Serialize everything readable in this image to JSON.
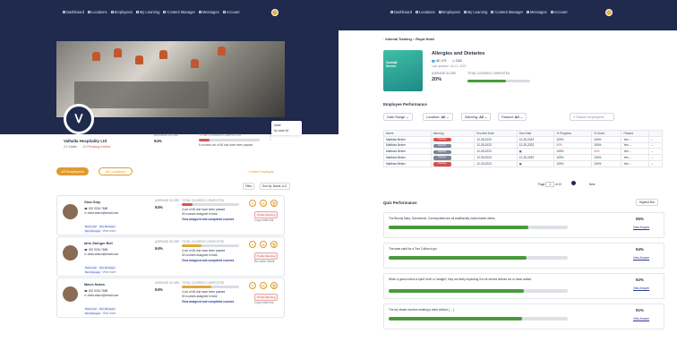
{
  "left": {
    "nav": [
      "Dashboard",
      "Locations",
      "Employees",
      "My Learning",
      "Content Manager",
      "Messages",
      "Account"
    ],
    "company": {
      "name": "Valhalla Hospitality Ltd",
      "staffs": "21 Staffs",
      "pending": "12 Pending Invites",
      "avg_label": "AVERAGE SCORE",
      "avg_value": "94%",
      "total_label": "TOTAL COURSES COMPLETED",
      "total_note": "8 courses out of 48 due have been passed",
      "progress": 0.17
    },
    "popover": {
      "line1": "Invite",
      "line2": "for route 40"
    },
    "tabs": {
      "all": "All Employees",
      "all_locations": "All Locations"
    },
    "invite": "+ Invite Employee",
    "filters": "Filter",
    "sort": "Sort by: Name, A-Z",
    "employees": [
      {
        "name": "Gina Gray",
        "phone": "002 9234 7688",
        "email": "olivia.wilson@email.com",
        "tags": [
          "Bartender",
          "Bar Manager"
        ],
        "tags2": [
          "Bar Manager"
        ],
        "more": "View more",
        "avg": "94%",
        "avg_label": "AVERAGE SCORE",
        "total_label": "TOTAL COURSES COMPLETED",
        "line1": "4 out of 48 due have been passed",
        "line2": "30 courses assigned in total",
        "link": "View assigned and completed courses",
        "progress": 0.18,
        "color": "#d25a4f",
        "warn": "Profile Warning",
        "inv": "Copy invite link"
      },
      {
        "name": "Idris Stringer Bell",
        "phone": "002 9234 7688",
        "email": "olivia.wilson@email.com",
        "tags": [
          "Bartender",
          "Bar Manager"
        ],
        "tags2": [
          "Bar Manager"
        ],
        "more": "View more",
        "avg": "94%",
        "avg_label": "AVERAGE SCORE",
        "total_label": "TOTAL COURSES COMPLETED",
        "line1": "4 out of 48 due have been passed",
        "line2": "30 courses assigned in total",
        "link": "View assigned and completed courses",
        "progress": 0.34,
        "color": "#e0a93c",
        "warn": "Profile Warning",
        "inv": "Re-invite Delete"
      },
      {
        "name": "Mavis Nokes",
        "phone": "002 9234 7688",
        "email": "olivia.wilson@email.com",
        "tags": [
          "Bartender",
          "Bar Manager"
        ],
        "tags2": [
          "Bar Manager"
        ],
        "more": "View more",
        "avg": "94%",
        "avg_label": "AVERAGE SCORE",
        "total_label": "TOTAL COURSES COMPLETED",
        "line1": "4 out of 48 due have been passed",
        "line2": "30 courses assigned in total",
        "link": "View assigned and completed courses",
        "progress": 0.52,
        "color": "#e0a93c",
        "warn": "Profile Warning",
        "inv": "Copy invite link"
      }
    ]
  },
  "right": {
    "nav": [
      "Dashboard",
      "Locations",
      "Employees",
      "My Learning",
      "Content Manager",
      "Messages",
      "Account"
    ],
    "breadcrumb": {
      "part1": "Internal Training",
      "sep": ">",
      "part2": "Royal Hotel"
    },
    "course": {
      "thumb": "Cocktail Service",
      "title": "Allergies and Dietaries",
      "stat1": "48 / 473",
      "stat2": "1163",
      "updated": "Last updated: Oct 12, 2023",
      "avg_label": "AVERAGE SCORE",
      "avg": "20%",
      "total_label": "TOTAL COURSES COMPLETED",
      "progress": 0.62
    },
    "perf_title": "Employee Performance",
    "filters": [
      {
        "label": "Date Range"
      },
      {
        "label": "Location:",
        "value": "All"
      },
      {
        "label": "Warning:",
        "value": "All"
      },
      {
        "label": "Passed:",
        "value": "All"
      }
    ],
    "search": "Search employees",
    "headers": [
      "Name",
      "Warning",
      "Enrolled Date",
      "Due Date",
      "% Progress",
      "% Score",
      "Passed"
    ],
    "rows": [
      {
        "name": "Matthias Beiser",
        "status": "Overdue",
        "enrolled": "12-25-2023",
        "due": "12-25-2023",
        "progress": "100%",
        "score": "100%",
        "passed": "Yes"
      },
      {
        "name": "Matthias Beiser",
        "status": "Expired",
        "enrolled": "12-25-2023",
        "due": "12-25-2023",
        "progress": "50%",
        "score": "100%",
        "passed": "Yes"
      },
      {
        "name": "Matthias Beiser",
        "status": "Expired",
        "enrolled": "12-25-2023",
        "due": "",
        "progress": "100%",
        "score": "40%",
        "passed": "Yes"
      },
      {
        "name": "Matthias Beiser",
        "status": "Expired",
        "enrolled": "12-25-2023",
        "due": "12-25-2023",
        "progress": "100%",
        "score": "100%",
        "passed": "Yes"
      },
      {
        "name": "Matthias Beiser",
        "status": "Overdue",
        "enrolled": "12-25-2023",
        "due": "",
        "progress": "100%",
        "score": "100%",
        "passed": "Yes"
      }
    ],
    "pager": {
      "page": "Page",
      "num": "1",
      "of": "of 10",
      "next": "Next"
    },
    "quiz_title": "Quiz Performance",
    "quiz_sort": "Highest first",
    "quiz": [
      {
        "q": "The Bloody Mary, Screwdriver, Cosmopolitan are all traditionally vodka based drinks.",
        "pct": "95%",
        "link": "View Answer",
        "v": 0.95
      },
      {
        "q": "The base spirit for a Tom Collins is gin",
        "pct": "94%",
        "link": "View Answer",
        "v": 0.94
      },
      {
        "q": "When a guest orders a spirit 'neat' or 'straight', they are likely expecting it to be served without ice or mixer added",
        "pct": "92%",
        "link": "View Answer",
        "v": 0.92
      },
      {
        "q": "The dry shake involves shaking a drink without [ ... ]",
        "pct": "91%",
        "link": "View Answer",
        "v": 0.91
      }
    ]
  },
  "colors": {
    "navy": "#1f2a4d",
    "accent": "#e09a2e",
    "green": "#4a9a3c",
    "red": "#d25a4f"
  }
}
